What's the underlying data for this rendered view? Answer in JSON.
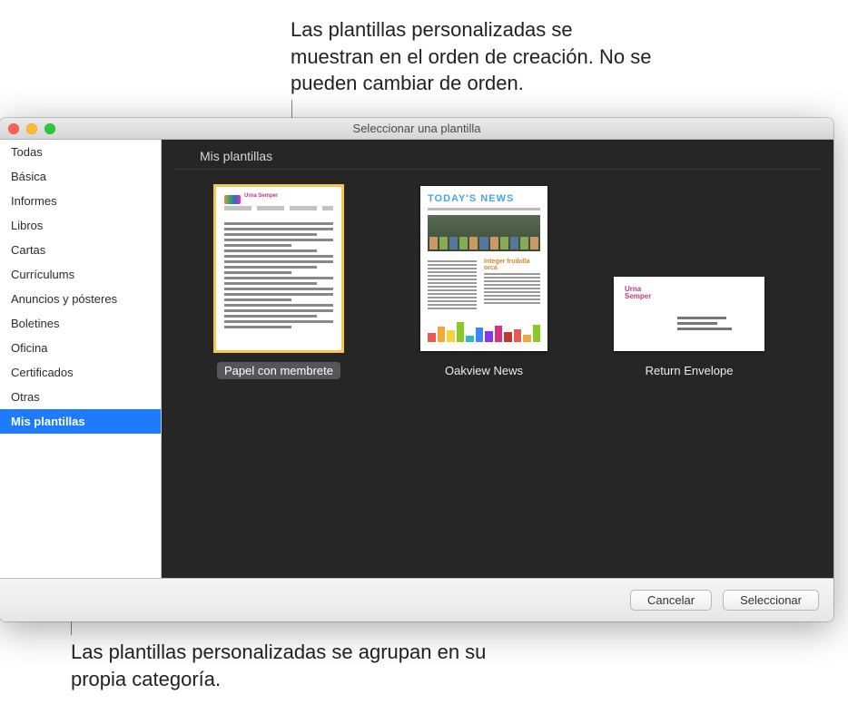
{
  "callouts": {
    "top": "Las plantillas personalizadas se muestran en el orden de creación. No se pueden cambiar de orden.",
    "bottom": "Las plantillas personalizadas se agrupan en su propia categoría."
  },
  "window": {
    "title": "Seleccionar una plantilla"
  },
  "sidebar": {
    "items": [
      {
        "label": "Todas",
        "selected": false
      },
      {
        "label": "Básica",
        "selected": false
      },
      {
        "label": "Informes",
        "selected": false
      },
      {
        "label": "Libros",
        "selected": false
      },
      {
        "label": "Cartas",
        "selected": false
      },
      {
        "label": "Currículums",
        "selected": false
      },
      {
        "label": "Anuncios y pósteres",
        "selected": false
      },
      {
        "label": "Boletines",
        "selected": false
      },
      {
        "label": "Oficina",
        "selected": false
      },
      {
        "label": "Certificados",
        "selected": false
      },
      {
        "label": "Otras",
        "selected": false
      },
      {
        "label": "Mis plantillas",
        "selected": true
      }
    ]
  },
  "main": {
    "section_header": "Mis plantillas",
    "templates": [
      {
        "label": "Papel con membrete",
        "selected": true,
        "kind": "letter"
      },
      {
        "label": "Oakview News",
        "selected": false,
        "kind": "news"
      },
      {
        "label": "Return Envelope",
        "selected": false,
        "kind": "envelope"
      }
    ],
    "thumbs": {
      "letter_name": "Urna Semper",
      "news_masthead": "TODAY'S NEWS",
      "news_headline": "Integer fruibilla orca",
      "env_name_1": "Urna",
      "env_name_2": "Semper"
    }
  },
  "footer": {
    "cancel": "Cancelar",
    "select": "Seleccionar"
  }
}
